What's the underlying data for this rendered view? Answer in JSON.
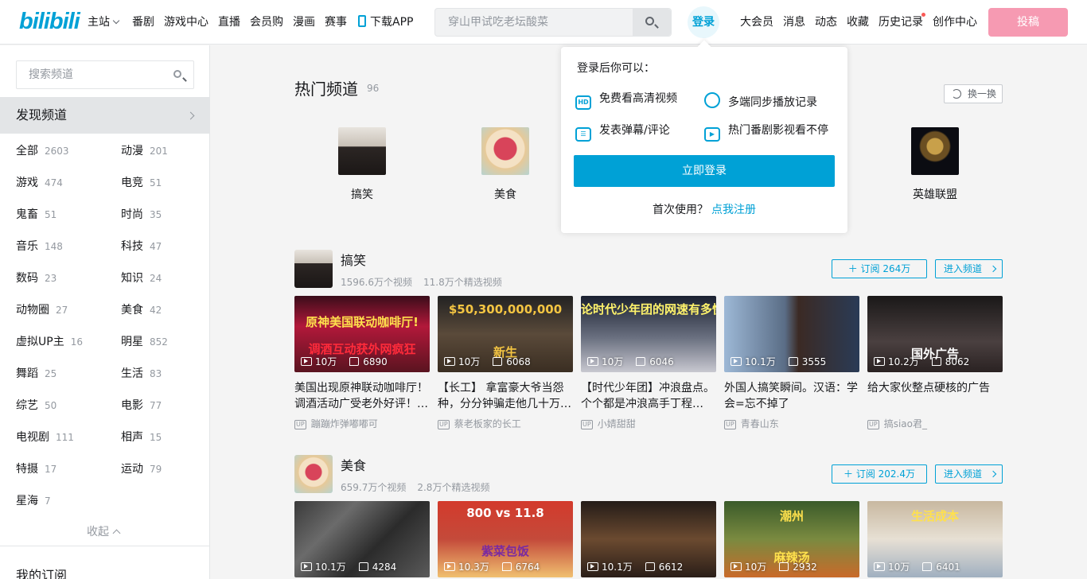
{
  "header": {
    "logo": "bilibili",
    "nav": [
      "主站",
      "番剧",
      "游戏中心",
      "直播",
      "会员购",
      "漫画",
      "赛事",
      "下载APP"
    ],
    "search_placeholder": "穿山甲试吃老坛酸菜",
    "login": "登录",
    "right_nav": [
      "大会员",
      "消息",
      "动态",
      "收藏",
      "历史记录",
      "创作中心"
    ],
    "upload": "投稿"
  },
  "sidebar": {
    "search_placeholder": "搜索频道",
    "discover": "发现频道",
    "categories": [
      {
        "name": "全部",
        "count": "2603"
      },
      {
        "name": "动漫",
        "count": "201"
      },
      {
        "name": "游戏",
        "count": "474"
      },
      {
        "name": "电竞",
        "count": "51"
      },
      {
        "name": "鬼畜",
        "count": "51"
      },
      {
        "name": "时尚",
        "count": "35"
      },
      {
        "name": "音乐",
        "count": "148"
      },
      {
        "name": "科技",
        "count": "47"
      },
      {
        "name": "数码",
        "count": "23"
      },
      {
        "name": "知识",
        "count": "24"
      },
      {
        "name": "动物圈",
        "count": "27"
      },
      {
        "name": "美食",
        "count": "42"
      },
      {
        "name": "虚拟UP主",
        "count": "16"
      },
      {
        "name": "明星",
        "count": "852"
      },
      {
        "name": "舞蹈",
        "count": "25"
      },
      {
        "name": "生活",
        "count": "83"
      },
      {
        "name": "综艺",
        "count": "50"
      },
      {
        "name": "电影",
        "count": "77"
      },
      {
        "name": "电视剧",
        "count": "111"
      },
      {
        "name": "相声",
        "count": "15"
      },
      {
        "name": "特摄",
        "count": "17"
      },
      {
        "name": "运动",
        "count": "79"
      },
      {
        "name": "星海",
        "count": "7"
      }
    ],
    "collapse": "收起",
    "my_subscriptions": "我的订阅"
  },
  "hot": {
    "title": "热门频道",
    "count": "96",
    "swap": "换一换",
    "items": [
      "搞笑",
      "美食",
      "英雄联盟"
    ]
  },
  "channels": [
    {
      "name": "搞笑",
      "videos_total": "1596.6万个视频",
      "featured_total": "11.8万个精选视频",
      "subscribe": "订阅 264万",
      "enter": "进入频道",
      "videos": [
        {
          "thumb_text": "原神美国联动咖啡厅!",
          "thumb_text2": "调酒互动获外网疯狂",
          "plays": "10万",
          "likes": "6890",
          "title": "美国出现原神联动咖啡厅！调酒活动广受老外好评！…",
          "up": "蹦蹦炸弹嘟嘟可"
        },
        {
          "thumb_text": "$50,300,000,000",
          "thumb_text2": "新生",
          "plays": "10万",
          "likes": "6068",
          "title": "【长工】 拿富豪大爷当怨种，分分钟骗走他几十万…",
          "up": "蔡老板家的长工"
        },
        {
          "thumb_text": "论时代少年团的网速有多快",
          "thumb_text2": "",
          "plays": "10万",
          "likes": "6046",
          "title": "【时代少年团】冲浪盘点。个个都是冲浪高手丁程…",
          "up": "小婧甜甜"
        },
        {
          "thumb_text": "",
          "thumb_text2": "",
          "plays": "10.1万",
          "likes": "3555",
          "title": "外国人搞笑瞬间。汉语：学会=忘不掉了",
          "up": "青春山东"
        },
        {
          "thumb_text": "国外广告",
          "thumb_text2": "",
          "plays": "10.2万",
          "likes": "8062",
          "title": "给大家伙整点硬核的广告",
          "up": "搞siao君_"
        }
      ]
    },
    {
      "name": "美食",
      "videos_total": "659.7万个视频",
      "featured_total": "2.8万个精选视频",
      "subscribe": "订阅 202.4万",
      "enter": "进入频道",
      "videos": [
        {
          "thumb_text": "",
          "plays": "10.1万",
          "likes": "4284"
        },
        {
          "thumb_text": "800 vs 11.8",
          "thumb_text2": "紫菜包饭",
          "plays": "10.3万",
          "likes": "6764"
        },
        {
          "thumb_text": "",
          "thumb_text2": "",
          "plays": "10.1万",
          "likes": "6612"
        },
        {
          "thumb_text": "潮州",
          "thumb_text2": "麻辣汤",
          "plays": "10万",
          "likes": "2932"
        },
        {
          "thumb_text": "生活成本",
          "thumb_text2": "",
          "plays": "10万",
          "likes": "6401"
        }
      ]
    }
  ],
  "login_popup": {
    "heading": "登录后你可以：",
    "features": [
      "免费看高清视频",
      "多端同步播放记录",
      "发表弹幕/评论",
      "热门番剧影视看不停"
    ],
    "button": "立即登录",
    "first_use": "首次使用？",
    "register": "点我注册"
  },
  "colors": {
    "accent": "#00a1d6",
    "upload": "#f69ab2"
  }
}
